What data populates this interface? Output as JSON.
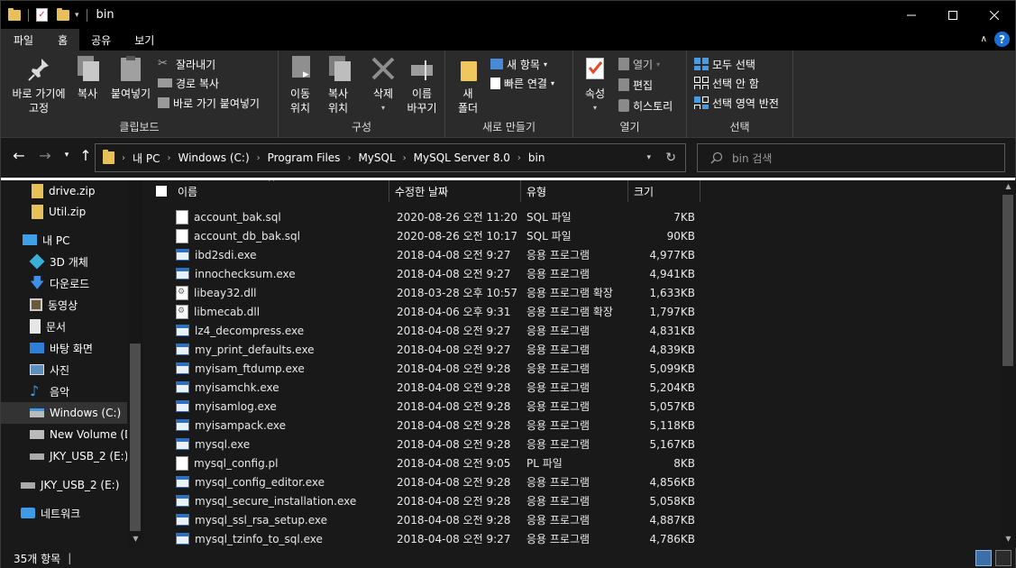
{
  "window": {
    "title": "bin"
  },
  "ribbon_tabs": [
    "파일",
    "홈",
    "공유",
    "보기"
  ],
  "ribbon": {
    "clipboard": {
      "label": "클립보드",
      "pin": "바로 가기에\n고정",
      "copy": "복사",
      "paste": "붙여넣기",
      "cut": "잘라내기",
      "copy_path": "경로 복사",
      "paste_shortcut": "바로 가기 붙여넣기"
    },
    "organize": {
      "label": "구성",
      "move_to": "이동\n위치",
      "copy_to": "복사\n위치",
      "delete": "삭제",
      "rename": "이름\n바꾸기"
    },
    "new": {
      "label": "새로 만들기",
      "new_folder": "새\n폴더",
      "new_item": "새 항목",
      "easy_access": "빠른 연결"
    },
    "open": {
      "label": "열기",
      "properties": "속성",
      "open": "열기",
      "edit": "편집",
      "history": "히스토리"
    },
    "select": {
      "label": "선택",
      "select_all": "모두 선택",
      "select_none": "선택 안 함",
      "invert": "선택 영역 반전"
    }
  },
  "breadcrumb": [
    "내 PC",
    "Windows (C:)",
    "Program Files",
    "MySQL",
    "MySQL Server 8.0",
    "bin"
  ],
  "search": {
    "placeholder": "bin 검색"
  },
  "nav": [
    {
      "label": "drive.zip",
      "icon": "zip-icon"
    },
    {
      "label": "Util.zip",
      "icon": "zip-icon"
    },
    {
      "label": "내 PC",
      "icon": "pc-icon"
    },
    {
      "label": "3D 개체",
      "icon": "3d-objects-icon"
    },
    {
      "label": "다운로드",
      "icon": "download-icon"
    },
    {
      "label": "동영상",
      "icon": "video-icon"
    },
    {
      "label": "문서",
      "icon": "document-icon"
    },
    {
      "label": "바탕 화면",
      "icon": "desktop-icon"
    },
    {
      "label": "사진",
      "icon": "pictures-icon"
    },
    {
      "label": "음악",
      "icon": "music-icon"
    },
    {
      "label": "Windows (C:)",
      "icon": "drive-icon"
    },
    {
      "label": "New Volume (D",
      "icon": "drive-icon"
    },
    {
      "label": "JKY_USB_2 (E:)",
      "icon": "usb-icon"
    },
    {
      "label": "JKY_USB_2 (E:)",
      "icon": "usb-icon"
    },
    {
      "label": "네트워크",
      "icon": "network-icon"
    }
  ],
  "columns": {
    "name": "이름",
    "date": "수정한 날짜",
    "type": "유형",
    "size": "크기"
  },
  "files": [
    {
      "name": "account_bak.sql",
      "date": "2020-08-26 오전 11:20",
      "type": "SQL 파일",
      "size": "7KB",
      "kind": "txt"
    },
    {
      "name": "account_db_bak.sql",
      "date": "2020-08-26 오전 10:17",
      "type": "SQL 파일",
      "size": "90KB",
      "kind": "txt"
    },
    {
      "name": "ibd2sdi.exe",
      "date": "2018-04-08 오전 9:27",
      "type": "응용 프로그램",
      "size": "4,977KB",
      "kind": "exe"
    },
    {
      "name": "innochecksum.exe",
      "date": "2018-04-08 오전 9:27",
      "type": "응용 프로그램",
      "size": "4,941KB",
      "kind": "exe"
    },
    {
      "name": "libeay32.dll",
      "date": "2018-03-28 오후 10:57",
      "type": "응용 프로그램 확장",
      "size": "1,633KB",
      "kind": "dll"
    },
    {
      "name": "libmecab.dll",
      "date": "2018-04-06 오후 9:31",
      "type": "응용 프로그램 확장",
      "size": "1,797KB",
      "kind": "dll"
    },
    {
      "name": "lz4_decompress.exe",
      "date": "2018-04-08 오전 9:27",
      "type": "응용 프로그램",
      "size": "4,831KB",
      "kind": "exe"
    },
    {
      "name": "my_print_defaults.exe",
      "date": "2018-04-08 오전 9:27",
      "type": "응용 프로그램",
      "size": "4,839KB",
      "kind": "exe"
    },
    {
      "name": "myisam_ftdump.exe",
      "date": "2018-04-08 오전 9:28",
      "type": "응용 프로그램",
      "size": "5,099KB",
      "kind": "exe"
    },
    {
      "name": "myisamchk.exe",
      "date": "2018-04-08 오전 9:28",
      "type": "응용 프로그램",
      "size": "5,204KB",
      "kind": "exe"
    },
    {
      "name": "myisamlog.exe",
      "date": "2018-04-08 오전 9:28",
      "type": "응용 프로그램",
      "size": "5,057KB",
      "kind": "exe"
    },
    {
      "name": "myisampack.exe",
      "date": "2018-04-08 오전 9:28",
      "type": "응용 프로그램",
      "size": "5,118KB",
      "kind": "exe"
    },
    {
      "name": "mysql.exe",
      "date": "2018-04-08 오전 9:28",
      "type": "응용 프로그램",
      "size": "5,167KB",
      "kind": "exe"
    },
    {
      "name": "mysql_config.pl",
      "date": "2018-04-08 오전 9:05",
      "type": "PL 파일",
      "size": "8KB",
      "kind": "txt"
    },
    {
      "name": "mysql_config_editor.exe",
      "date": "2018-04-08 오전 9:28",
      "type": "응용 프로그램",
      "size": "4,856KB",
      "kind": "exe"
    },
    {
      "name": "mysql_secure_installation.exe",
      "date": "2018-04-08 오전 9:28",
      "type": "응용 프로그램",
      "size": "5,058KB",
      "kind": "exe"
    },
    {
      "name": "mysql_ssl_rsa_setup.exe",
      "date": "2018-04-08 오전 9:28",
      "type": "응용 프로그램",
      "size": "4,887KB",
      "kind": "exe"
    },
    {
      "name": "mysql_tzinfo_to_sql.exe",
      "date": "2018-04-08 오전 9:27",
      "type": "응용 프로그램",
      "size": "4,786KB",
      "kind": "exe"
    }
  ],
  "status": {
    "count": "35개 항목"
  }
}
